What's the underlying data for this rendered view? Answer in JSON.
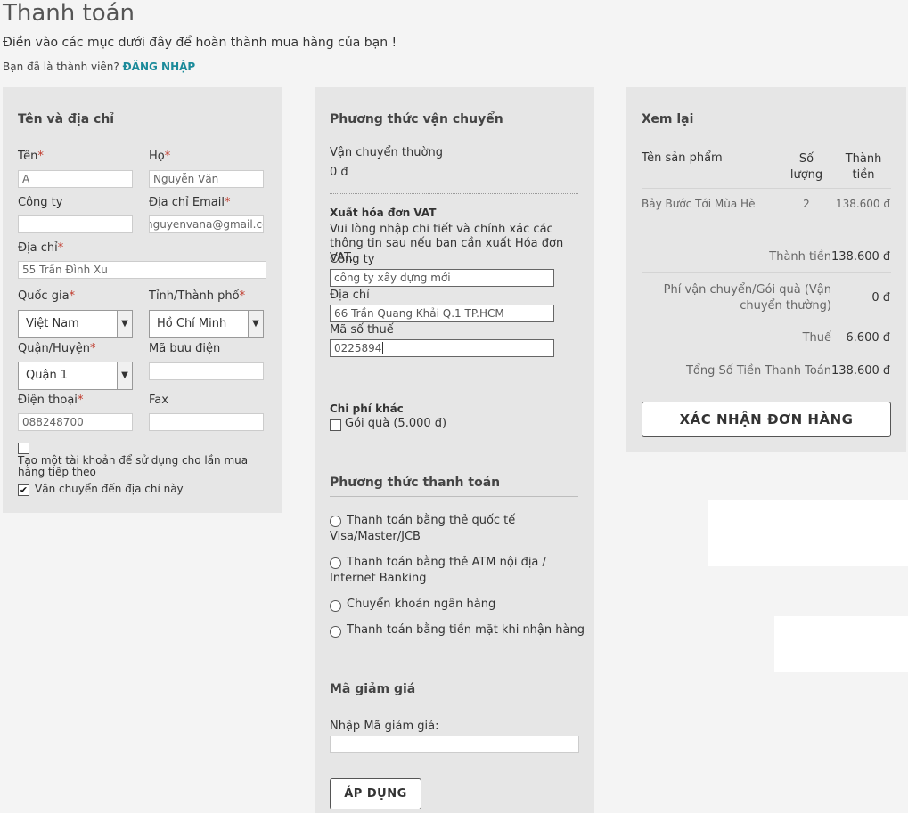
{
  "header": {
    "title": "Thanh toán",
    "subtitle": "Điền vào các mục dưới đây để hoàn thành mua hàng của bạn !",
    "member_question": "Bạn đã là thành viên?",
    "login_label": "ĐĂNG NHẬP"
  },
  "address": {
    "title": "Tên và địa chỉ",
    "first_name_label": "Tên",
    "first_name_value": "A",
    "last_name_label": "Họ",
    "last_name_value": "Nguyễn Văn",
    "company_label": "Công ty",
    "company_value": "",
    "email_label": "Địa chỉ Email",
    "email_value": "nguyenvana@gmail.com",
    "address_label": "Địa chỉ",
    "address_value": "55 Trần Đình Xu",
    "country_label": "Quốc gia",
    "country_value": "Việt Nam",
    "province_label": "Tỉnh/Thành phố",
    "province_value": "Hồ Chí Minh",
    "district_label": "Quận/Huyện",
    "district_value": "Quận 1",
    "postal_label": "Mã bưu điện",
    "postal_value": "",
    "phone_label": "Điện thoại",
    "phone_value": "088248700",
    "fax_label": "Fax",
    "fax_value": "",
    "create_account_label": "Tạo một tài khoản để sử dụng cho lần mua hàng tiếp theo",
    "create_account_checked": false,
    "ship_here_label": "Vận chuyển đến địa chỉ này",
    "ship_here_checked": true,
    "required_mark": "*"
  },
  "shipping": {
    "title": "Phương thức vận chuyển",
    "method": "Vận chuyển thường",
    "price": "0 đ",
    "vat_title": "Xuất hóa đơn VAT",
    "vat_desc": "Vui lòng nhập chi tiết và chính xác các thông tin sau nếu bạn cần xuất Hóa đơn VAT.",
    "vat_company_label": "Công ty",
    "vat_company_value": "công ty xây dựng mới",
    "vat_address_label": "Địa chỉ",
    "vat_address_value": "66 Trần Quang Khải Q.1 TP.HCM",
    "vat_tax_label": "Mã số thuế",
    "vat_tax_value": "0225894",
    "other_fees_title": "Chi phí khác",
    "gift_label": "Gói quà (5.000 đ)"
  },
  "payment": {
    "title": "Phương thức thanh toán",
    "options": [
      "Thanh toán bằng thẻ quốc tế Visa/Master/JCB",
      "Thanh toán bằng thẻ ATM nội địa / Internet Banking",
      "Chuyển khoản ngân hàng",
      "Thanh toán bằng tiền mặt khi nhận hàng"
    ]
  },
  "coupon": {
    "title": "Mã giảm giá",
    "label": "Nhập Mã giảm giá:",
    "value": "",
    "apply_label": "ÁP DỤNG"
  },
  "review": {
    "title": "Xem lại",
    "col_product": "Tên sản phẩm",
    "col_qty": "Số lượng",
    "col_total": "Thành tiền",
    "items": [
      {
        "name": "Bảy Bước Tới Mùa Hè",
        "qty": "2",
        "total": "138.600 đ"
      }
    ],
    "subtotal_label": "Thành tiền",
    "subtotal_value": "138.600 đ",
    "shipping_label": "Phí vận chuyển/Gói quà (Vận chuyển thường)",
    "shipping_value": "0 đ",
    "tax_label": "Thuế",
    "tax_value": "6.600 đ",
    "grand_label": "Tổng Số Tiền Thanh Toán",
    "grand_value": "138.600 đ",
    "confirm_label": "XÁC NHẬN ĐƠN HÀNG"
  }
}
